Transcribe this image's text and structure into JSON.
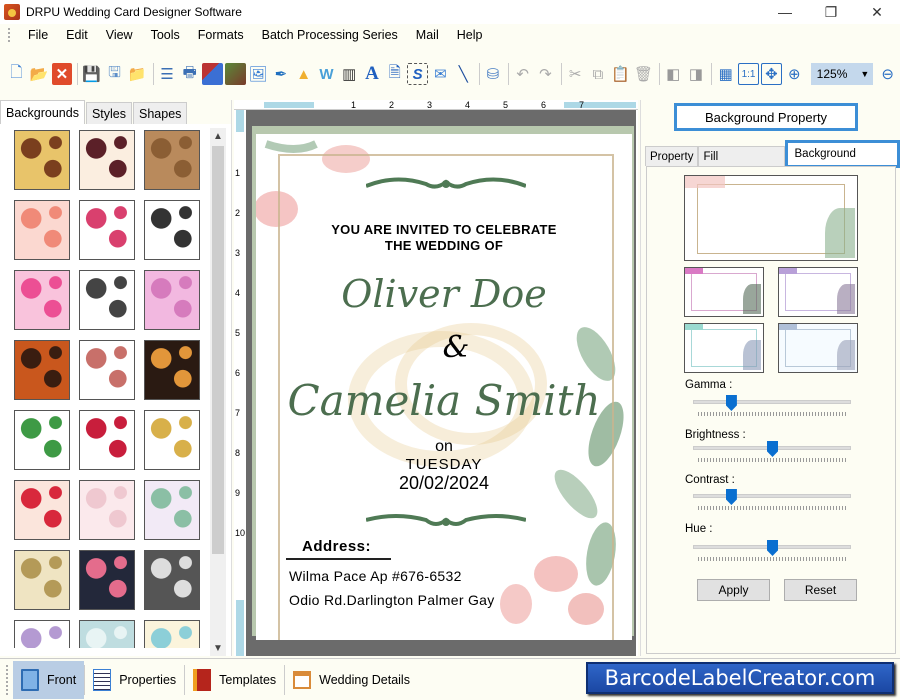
{
  "window": {
    "title": "DRPU Wedding Card Designer Software",
    "controls": {
      "minimize": "—",
      "maximize": "❐",
      "close": "✕"
    }
  },
  "menu": [
    "File",
    "Edit",
    "View",
    "Tools",
    "Formats",
    "Batch Processing Series",
    "Mail",
    "Help"
  ],
  "toolbar": {
    "icons": [
      "new-icon",
      "open-icon",
      "close-icon",
      "save-icon",
      "save-as-icon",
      "import-icon",
      "page-setup-icon",
      "print-icon",
      "print-multiple-icon",
      "background-icon",
      "image-insert-icon",
      "pencil-icon",
      "shapes-icon",
      "wordart-icon",
      "barcode-icon",
      "text-icon",
      "text-box-icon",
      "signature-icon",
      "email-icon",
      "line-icon",
      "database-icon",
      "undo-icon",
      "redo-icon",
      "cut-icon",
      "copy-icon",
      "paste-icon",
      "delete-icon",
      "bring-front-icon",
      "send-back-icon",
      "grid-icon",
      "actual-size-icon",
      "fit-window-icon",
      "zoom-in-icon"
    ],
    "zoom_value": "125%",
    "zoom_out": "zoom-out-icon"
  },
  "left_panel": {
    "tabs": [
      "Backgrounds",
      "Styles",
      "Shapes"
    ],
    "active_tab": "Backgrounds",
    "thumbnails": [
      {
        "name": "golden-butterfly-pattern",
        "c1": "#e8c46a",
        "c2": "#7a3f1e"
      },
      {
        "name": "paisley-pattern",
        "c1": "#fbeee0",
        "c2": "#5b2028"
      },
      {
        "name": "brown-tile-pattern",
        "c1": "#b98a5c",
        "c2": "#8b5e34"
      },
      {
        "name": "pink-floral-pattern",
        "c1": "#fbd8d0",
        "c2": "#f08a78"
      },
      {
        "name": "hearts-outline-pattern",
        "c1": "#ffffff",
        "c2": "#d9406e"
      },
      {
        "name": "wedding-mandap",
        "c1": "#ffffff",
        "c2": "#333333"
      },
      {
        "name": "pink-hearts",
        "c1": "#f9c3dc",
        "c2": "#ec4f94"
      },
      {
        "name": "dancing-couples",
        "c1": "#ffffff",
        "c2": "#444444"
      },
      {
        "name": "pink-swirls",
        "c1": "#f2b8e0",
        "c2": "#d67bbd"
      },
      {
        "name": "ganesha-orange",
        "c1": "#c9571d",
        "c2": "#3a1d10"
      },
      {
        "name": "elephant-head",
        "c1": "#ffffff",
        "c2": "#c8706a"
      },
      {
        "name": "black-floral",
        "c1": "#2a1a12",
        "c2": "#e2963a"
      },
      {
        "name": "green-leaf-ganesha",
        "c1": "#ffffff",
        "c2": "#3e9a45"
      },
      {
        "name": "rose-petals",
        "c1": "#ffffff",
        "c2": "#c81e3c"
      },
      {
        "name": "moon-star",
        "c1": "#ffffff",
        "c2": "#d8b04a"
      },
      {
        "name": "red-hearts-collage",
        "c1": "#fbe5dc",
        "c2": "#d8283c"
      },
      {
        "name": "pale-pink-lace",
        "c1": "#fbe9ec",
        "c2": "#efc8d0"
      },
      {
        "name": "mandala-green",
        "c1": "#f2eaf6",
        "c2": "#8bbfa5"
      },
      {
        "name": "cream-rose-rings",
        "c1": "#efe4c2",
        "c2": "#b49a58"
      },
      {
        "name": "dark-floral-strip",
        "c1": "#23283a",
        "c2": "#e46c8c"
      },
      {
        "name": "grey-lace",
        "c1": "#555555",
        "c2": "#dddddd"
      },
      {
        "name": "lilac-flowers",
        "c1": "#ffffff",
        "c2": "#b49ad2"
      },
      {
        "name": "aqua-hearts",
        "c1": "#bfdde0",
        "c2": "#e8f4f4"
      },
      {
        "name": "pastel-border-hearts",
        "c1": "#fbf4dc",
        "c2": "#8ccfd8"
      }
    ]
  },
  "rulers": {
    "horizontal": [
      "1",
      "2",
      "3",
      "4",
      "5",
      "6",
      "7"
    ],
    "vertical": [
      "1",
      "2",
      "3",
      "4",
      "5",
      "6",
      "7",
      "8",
      "9",
      "10"
    ]
  },
  "card": {
    "invite_line1": "YOU ARE INVITED TO CELEBRATE",
    "invite_line2": "THE WEDDING OF",
    "groom": "Oliver  Doe",
    "ampersand": "&",
    "bride": "Camelia  Smith",
    "on": "on",
    "day": "TUESDAY",
    "date": "20/02/2024",
    "address_label": "Address:",
    "address_line1": "Wilma Pace Ap #676-6532",
    "address_line2": "Odio Rd.Darlington Palmer Gay",
    "colors": {
      "script": "#4c6e4f",
      "ornament": "#4f7a55",
      "frame": "#c9b48f"
    }
  },
  "right_panel": {
    "title": "Background Property",
    "tabs": [
      "Property",
      "Fill Background",
      "Background Effects"
    ],
    "active_tab": "Background Effects",
    "previews": [
      "original-preview",
      "pink-tint-preview",
      "lilac-tint-preview",
      "aqua-tint-preview",
      "light-blue-tint-preview"
    ],
    "sliders": [
      {
        "label": "Gamma :",
        "value": 0.24
      },
      {
        "label": "Brightness :",
        "value": 0.5
      },
      {
        "label": "Contrast :",
        "value": 0.24
      },
      {
        "label": "Hue :",
        "value": 0.5
      }
    ],
    "apply_label": "Apply",
    "reset_label": "Reset"
  },
  "bottom_tabs": [
    {
      "label": "Front",
      "active": true
    },
    {
      "label": "Properties",
      "active": false
    },
    {
      "label": "Templates",
      "active": false
    },
    {
      "label": "Wedding Details",
      "active": false
    }
  ],
  "branding": "BarcodeLabelCreator.com",
  "accent_color": "#3c8ed6"
}
